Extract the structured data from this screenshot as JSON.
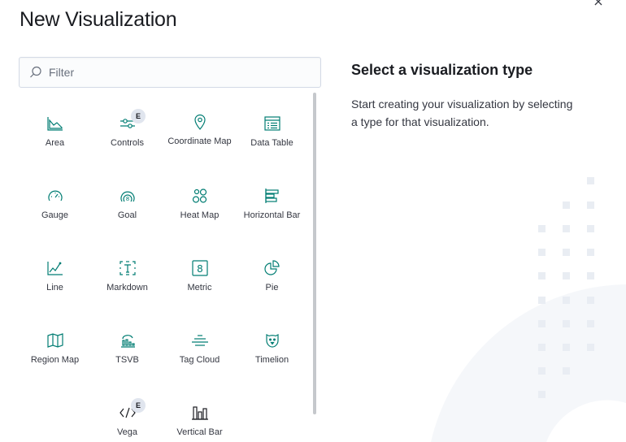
{
  "dialog": {
    "title": "New Visualization",
    "close_glyph": "×"
  },
  "search": {
    "placeholder": "Filter",
    "value": ""
  },
  "types": [
    {
      "label": "Area",
      "icon": "area-chart-icon"
    },
    {
      "label": "Controls",
      "icon": "controls-icon",
      "badge": "E"
    },
    {
      "label": "Coordinate Map",
      "icon": "map-marker-icon"
    },
    {
      "label": "Data Table",
      "icon": "table-icon"
    },
    {
      "label": "Gauge",
      "icon": "gauge-icon"
    },
    {
      "label": "Goal",
      "icon": "goal-icon"
    },
    {
      "label": "Heat Map",
      "icon": "heatmap-icon"
    },
    {
      "label": "Horizontal Bar",
      "icon": "horizontal-bar-icon"
    },
    {
      "label": "Line",
      "icon": "line-chart-icon"
    },
    {
      "label": "Markdown",
      "icon": "markdown-icon"
    },
    {
      "label": "Metric",
      "icon": "metric-icon"
    },
    {
      "label": "Pie",
      "icon": "pie-chart-icon"
    },
    {
      "label": "Region Map",
      "icon": "region-map-icon"
    },
    {
      "label": "TSVB",
      "icon": "tsvb-icon"
    },
    {
      "label": "Tag Cloud",
      "icon": "tag-cloud-icon"
    },
    {
      "label": "Timelion",
      "icon": "timelion-icon"
    },
    {
      "label": "Vega",
      "icon": "vega-code-icon",
      "badge": "E"
    },
    {
      "label": "Vertical Bar",
      "icon": "vertical-bar-icon"
    }
  ],
  "details": {
    "heading": "Select a visualization type",
    "description": "Start creating your visualization by selecting a type for that visualization."
  },
  "colors": {
    "accent": "#017d73",
    "badge_bg": "#e0e5ee",
    "illustration": "#f5f7fa"
  }
}
